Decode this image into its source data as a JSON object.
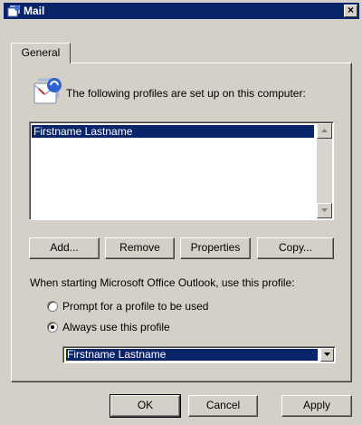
{
  "window": {
    "title": "Mail",
    "close_glyph": "×"
  },
  "tabs": [
    {
      "label": "General",
      "selected": true
    }
  ],
  "intro": {
    "text": "The following profiles are set up on this computer:",
    "icon": "mail-profiles-icon"
  },
  "profiles_list": {
    "items": [
      {
        "name": "Firstname Lastname",
        "selected": true
      }
    ]
  },
  "profile_buttons": {
    "add": "Add...",
    "remove": "Remove",
    "properties": "Properties",
    "copy": "Copy..."
  },
  "startup": {
    "label": "When starting Microsoft Office Outlook, use this profile:",
    "prompt_option": "Prompt for a profile to be used",
    "always_option": "Always use this profile",
    "selected_option": "always",
    "profile_select_value": "Firstname Lastname"
  },
  "footer_buttons": {
    "ok": "OK",
    "cancel": "Cancel",
    "apply": "Apply"
  },
  "colors": {
    "titlebar": "#0a246a",
    "selection": "#0a246a",
    "face": "#d4d0c8"
  }
}
